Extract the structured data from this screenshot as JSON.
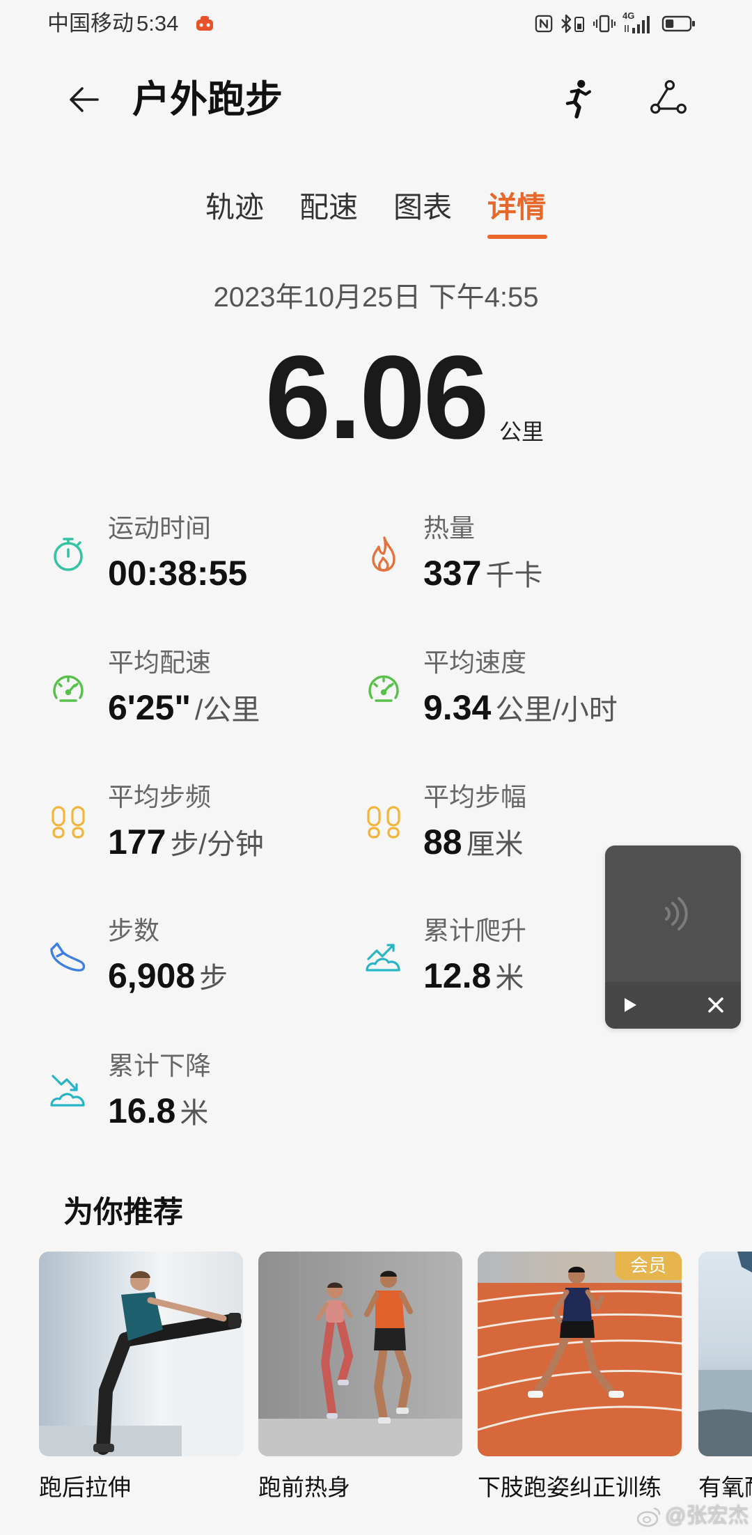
{
  "status_bar": {
    "carrier": "中国移动",
    "time": "5:34",
    "network_label": "4G",
    "battery_level": 0.35,
    "icons": [
      "app-notification-icon",
      "nfc-icon",
      "bluetooth-icon",
      "vibrate-icon",
      "signal-icon",
      "battery-icon"
    ]
  },
  "header": {
    "title": "户外跑步",
    "icons": {
      "back": "back-arrow-icon",
      "runner": "runner-icon",
      "route": "route-share-icon"
    }
  },
  "tabs": [
    {
      "label": "轨迹",
      "active": false
    },
    {
      "label": "配速",
      "active": false
    },
    {
      "label": "图表",
      "active": false
    },
    {
      "label": "详情",
      "active": true
    }
  ],
  "summary": {
    "datetime": "2023年10月25日 下午4:55",
    "distance": "6.06",
    "distance_unit": "公里"
  },
  "stats": [
    {
      "label": "运动时间",
      "value": "00:38:55",
      "unit": "",
      "icon": "stopwatch-icon",
      "color": "#35C3A3"
    },
    {
      "label": "热量",
      "value": "337",
      "unit": "千卡",
      "icon": "flame-icon",
      "color": "#E4723F"
    },
    {
      "label": "平均配速",
      "value": "6'25\"",
      "unit": "/公里",
      "icon": "speedometer-icon",
      "color": "#55C149"
    },
    {
      "label": "平均速度",
      "value": "9.34",
      "unit": "公里/小时",
      "icon": "speedometer-icon",
      "color": "#55C149"
    },
    {
      "label": "平均步频",
      "value": "177",
      "unit": "步/分钟",
      "icon": "footprints-icon",
      "color": "#F2B43A"
    },
    {
      "label": "平均步幅",
      "value": "88",
      "unit": "厘米",
      "icon": "footprints-icon",
      "color": "#F2B43A"
    },
    {
      "label": "步数",
      "value": "6,908",
      "unit": "步",
      "icon": "running-shoe-icon",
      "color": "#3D7FE3"
    },
    {
      "label": "累计爬升",
      "value": "12.8",
      "unit": "米",
      "icon": "elevation-gain-icon",
      "color": "#27B4C5"
    },
    {
      "label": "累计下降",
      "value": "16.8",
      "unit": "米",
      "icon": "elevation-loss-icon",
      "color": "#27B4C5"
    }
  ],
  "floating_player": {
    "icons": [
      "sound-wave-icon",
      "play-icon",
      "close-icon"
    ]
  },
  "recommend": {
    "title": "为你推荐",
    "cards": [
      {
        "label": "跑后拉伸"
      },
      {
        "label": "跑前热身"
      },
      {
        "label": "下肢跑姿纠正训练",
        "badge": "会员"
      },
      {
        "label": "有氧耐"
      }
    ]
  },
  "watermark": {
    "text": "@张宏杰",
    "icon": "weibo-logo-icon"
  },
  "colors": {
    "accent": "#E8682A",
    "background": "#F6F6F6",
    "badge": "#E6B54E"
  }
}
